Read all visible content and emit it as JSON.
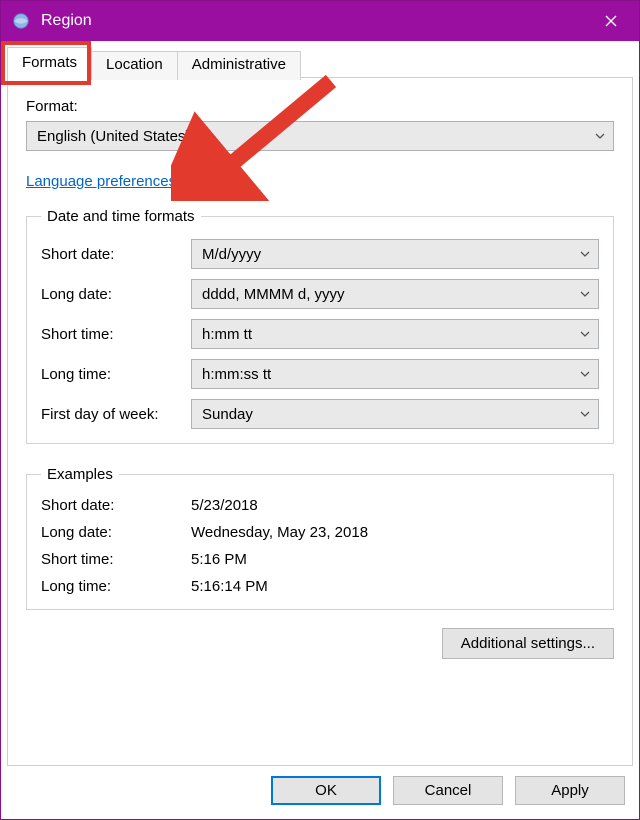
{
  "window": {
    "title": "Region"
  },
  "tabs": {
    "formats": "Formats",
    "location": "Location",
    "administrative": "Administrative"
  },
  "format": {
    "label": "Format:",
    "value": "English (United States)"
  },
  "language_prefs": "Language preferences",
  "groups": {
    "date_time": "Date and time formats",
    "examples": "Examples"
  },
  "dt": {
    "short_date": {
      "label": "Short date:",
      "value": "M/d/yyyy"
    },
    "long_date": {
      "label": "Long date:",
      "value": "dddd, MMMM d, yyyy"
    },
    "short_time": {
      "label": "Short time:",
      "value": "h:mm tt"
    },
    "long_time": {
      "label": "Long time:",
      "value": "h:mm:ss tt"
    },
    "first_day": {
      "label": "First day of week:",
      "value": "Sunday"
    }
  },
  "examples": {
    "short_date": {
      "label": "Short date:",
      "value": "5/23/2018"
    },
    "long_date": {
      "label": "Long date:",
      "value": "Wednesday, May 23, 2018"
    },
    "short_time": {
      "label": "Short time:",
      "value": "5:16 PM"
    },
    "long_time": {
      "label": "Long time:",
      "value": "5:16:14 PM"
    }
  },
  "buttons": {
    "additional": "Additional settings...",
    "ok": "OK",
    "cancel": "Cancel",
    "apply": "Apply"
  },
  "annotation": {
    "highlight_target": "Formats tab",
    "arrow_target": "Format dropdown",
    "arrow_color": "#e23b2e"
  }
}
